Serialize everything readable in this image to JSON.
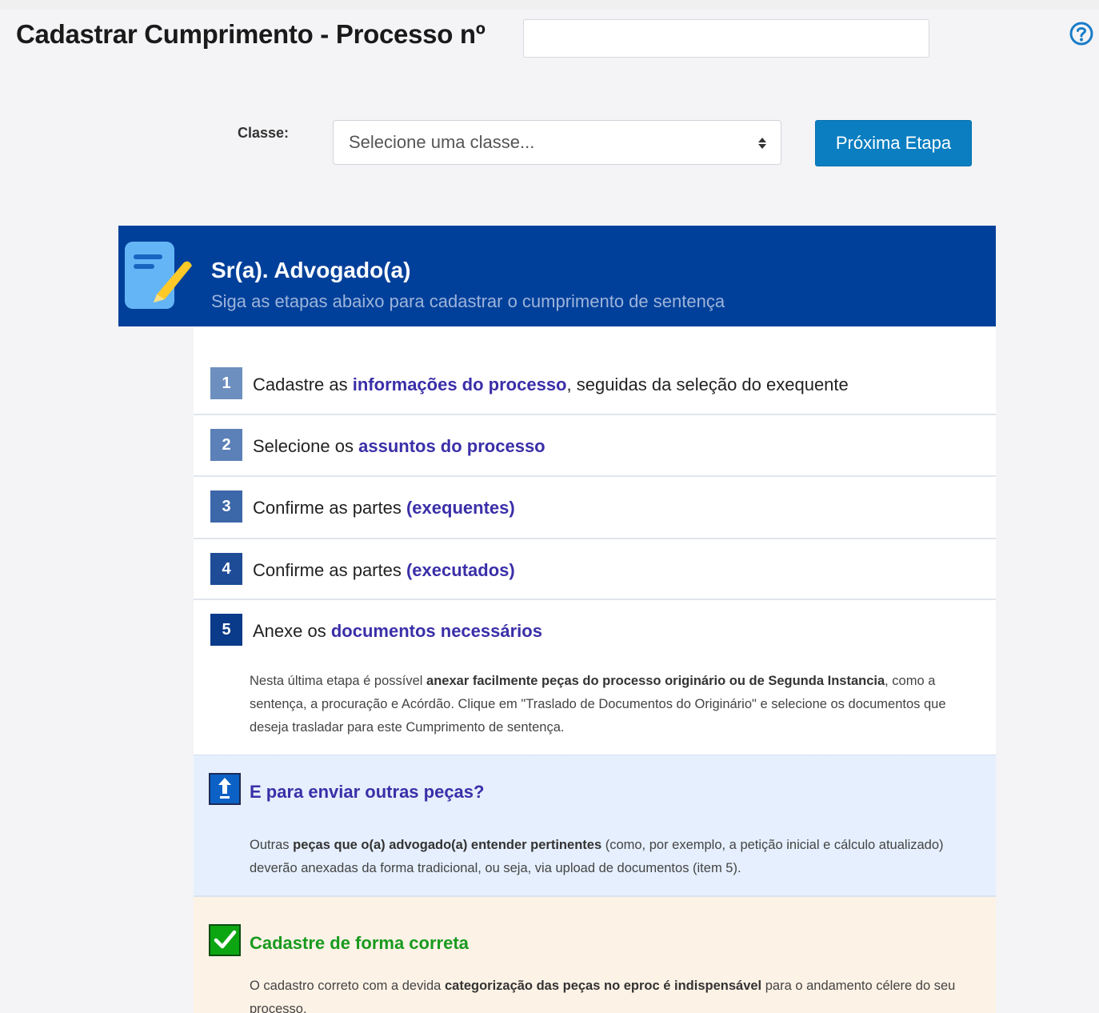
{
  "header": {
    "title": "Cadastrar Cumprimento - Processo nº",
    "process_number_value": "",
    "help_icon": "question-circle-icon"
  },
  "form": {
    "classe_label": "Classe:",
    "classe_placeholder": "Selecione uma classe...",
    "next_button_label": "Próxima Etapa"
  },
  "banner": {
    "icon": "document-edit-icon",
    "title": "Sr(a). Advogado(a)",
    "subtitle": "Siga as etapas abaixo para cadastrar o cumprimento de sentença"
  },
  "steps": [
    {
      "number": "1",
      "pre": "Cadastre as",
      "highlight": "informações do processo",
      "post": ", seguidas da seleção do exequente"
    },
    {
      "number": "2",
      "pre": "Selecione os",
      "highlight": "assuntos do processo",
      "post": ""
    },
    {
      "number": "3",
      "pre": "Confirme as partes",
      "highlight": "(exequentes)",
      "post": ""
    },
    {
      "number": "4",
      "pre": "Confirme as partes",
      "highlight": "(executados)",
      "post": ""
    },
    {
      "number": "5",
      "pre": "Anexe os",
      "highlight": "documentos necessários",
      "post": ""
    }
  ],
  "step5_note": {
    "pre": "Nesta última etapa é possível",
    "bold": "anexar facilmente peças do processo originário ou de Segunda Instancia",
    "post": ", como a sentença, a procuração e Acórdão. Clique em \"Traslado de Documentos do Originário\" e selecione os documentos que deseja trasladar para este Cumprimento de sentença."
  },
  "info_box": {
    "icon": "upload-icon",
    "title": "E para enviar outras peças?",
    "pre": "Outras",
    "bold": "peças que o(a) advogado(a) entender pertinentes",
    "post": " (como, por exemplo, a petição inicial e cálculo atualizado) deverão anexadas da forma tradicional, ou seja, via upload de documentos (item 5)."
  },
  "ok_box": {
    "icon": "checkmark-icon",
    "title": "Cadastre de forma correta",
    "pre": "O cadastro correto com a devida",
    "bold": "categorização das peças no eproc é indispensável",
    "post": " para o andamento célere do seu processo."
  },
  "colors": {
    "banner": "#01409a",
    "button": "#0a7ec0",
    "highlight": "#3a2fa8",
    "step_badge_colors": [
      "#6d8fbf",
      "#5c80b8",
      "#3c67a8",
      "#1e4c96",
      "#0a3a8a"
    ],
    "info_bg": "#e5effd",
    "ok_bg": "#fdf2e6",
    "ok_green": "#189a1e"
  }
}
